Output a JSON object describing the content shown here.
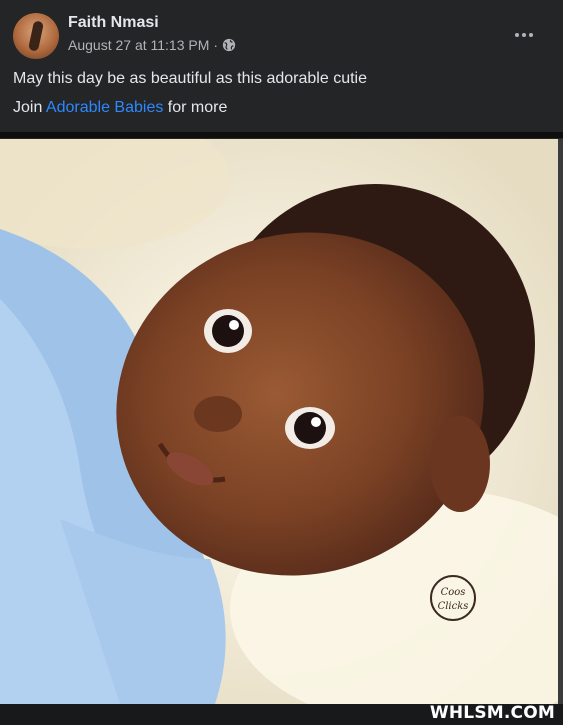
{
  "post": {
    "author": "Faith Nmasi",
    "timestamp": "August 27 at 11:13 PM",
    "separator": "·",
    "privacy_icon": "globe-icon",
    "caption": "May this day be as beautiful as this adorable cutie",
    "join_prefix": "Join ",
    "group_name": "Adorable Babies",
    "join_suffix": " for more"
  },
  "photo": {
    "logo_text_top": "Coos",
    "logo_text_bottom": "Clicks"
  },
  "watermark": "WHLSM.COM",
  "colors": {
    "background": "#242526",
    "text": "#e4e6eb",
    "secondary_text": "#b0b3b8",
    "link": "#2d88ff"
  }
}
